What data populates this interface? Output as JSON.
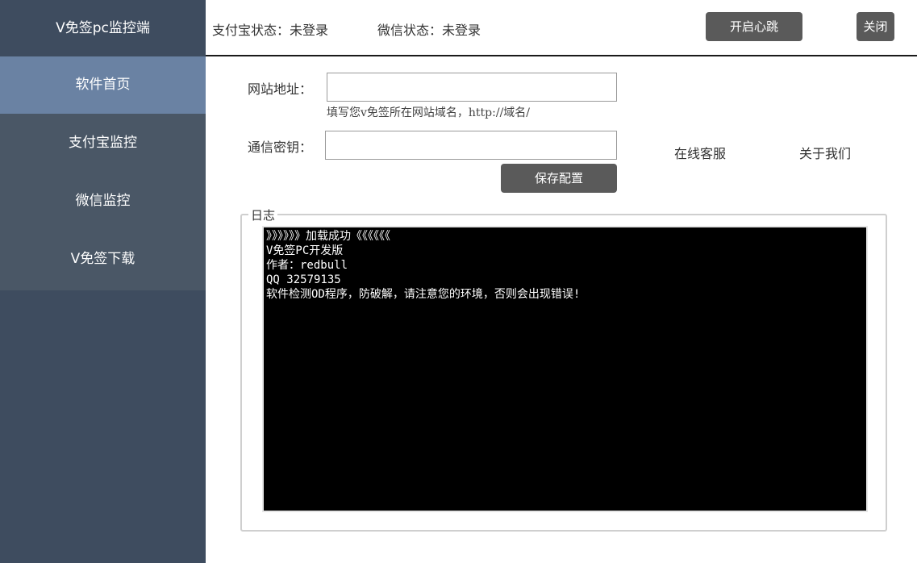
{
  "app": {
    "title": "V免签pc监控端"
  },
  "sidebar": {
    "items": [
      {
        "label": "软件首页",
        "active": true
      },
      {
        "label": "支付宝监控",
        "active": false
      },
      {
        "label": "微信监控",
        "active": false
      },
      {
        "label": "V免签下载",
        "active": false
      }
    ]
  },
  "topbar": {
    "alipay_status": "支付宝状态：未登录",
    "wechat_status": "微信状态：未登录",
    "heartbeat_button": "开启心跳",
    "close_button": "关闭"
  },
  "form": {
    "url_label": "网站地址：",
    "url_value": "",
    "url_hint": "填写您v免签所在网站域名，http://域名/",
    "key_label": "通信密钥：",
    "key_value": "",
    "save_button": "保存配置"
  },
  "links": {
    "customer_service": "在线客服",
    "about_us": "关于我们"
  },
  "log": {
    "legend": "日志",
    "lines": [
      "》》》》》》加载成功《《《《《《",
      "V免签PC开发版",
      "作者：redbull",
      "QQ 32579135",
      "软件检测OD程序，防破解，请注意您的环境，否则会出现错误!"
    ]
  },
  "colors": {
    "sidebar_bg": "#3e4c5f",
    "sidebar_menu_bg": "#4a5766",
    "sidebar_active_bg": "#6a82a3",
    "button_bg": "#5a5a5a",
    "console_bg": "#000000"
  }
}
